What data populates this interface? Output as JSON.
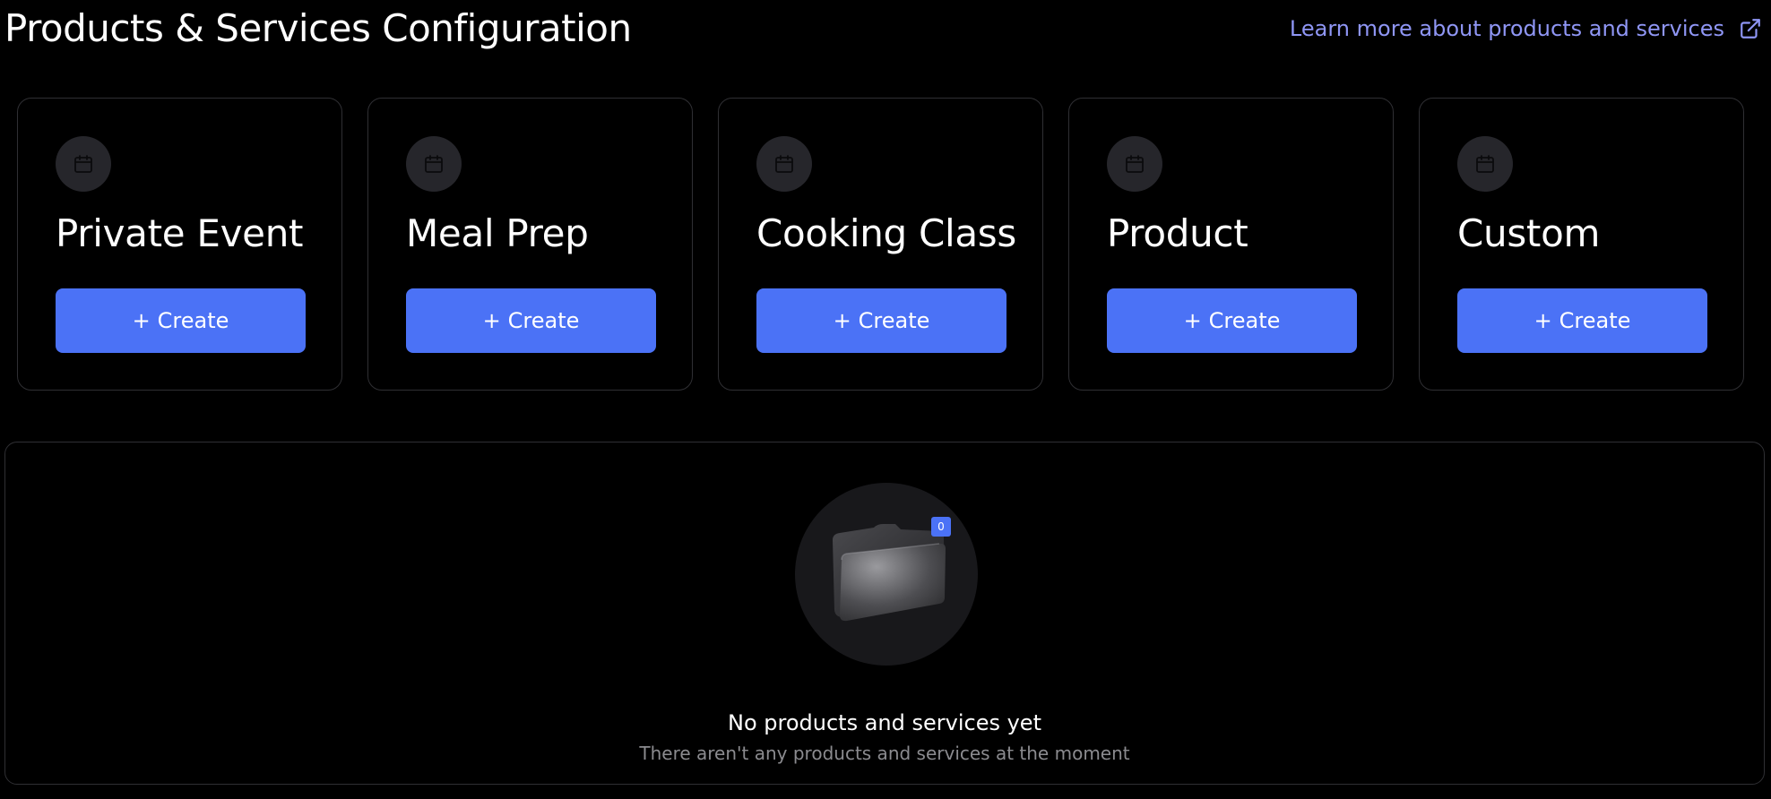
{
  "header": {
    "title": "Products & Services Configuration",
    "learn_more_link": "Learn more about products and services",
    "learn_more_icon": "external-link-icon"
  },
  "cards": [
    {
      "title": "Private Event",
      "icon": "calendar-icon",
      "button_plus": "+",
      "button_label": "Create"
    },
    {
      "title": "Meal Prep",
      "icon": "calendar-icon",
      "button_plus": "+",
      "button_label": "Create"
    },
    {
      "title": "Cooking Class",
      "icon": "calendar-icon",
      "button_plus": "+",
      "button_label": "Create"
    },
    {
      "title": "Product",
      "icon": "calendar-icon",
      "button_plus": "+",
      "button_label": "Create"
    },
    {
      "title": "Custom",
      "icon": "calendar-icon",
      "button_plus": "+",
      "button_label": "Create"
    }
  ],
  "empty_state": {
    "icon": "folder-icon",
    "badge_count": "0",
    "title": "No products and services yet",
    "subtitle": "There aren't any products and services at the moment"
  },
  "colors": {
    "background": "#000000",
    "accent": "#4b72f6",
    "link": "#8f96f5",
    "card_border": "#2f2f33",
    "muted_text": "#8b8b8f"
  }
}
